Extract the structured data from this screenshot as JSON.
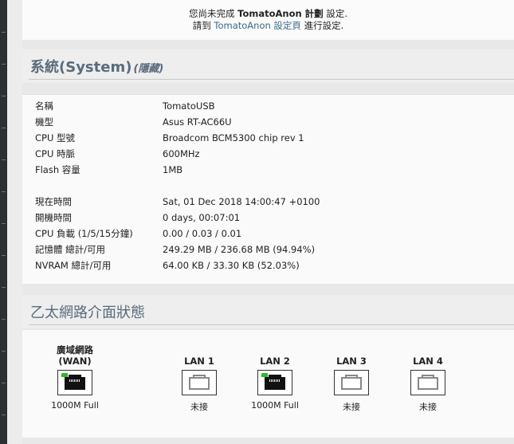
{
  "notice": {
    "line1_prefix": "您尚未完成 ",
    "line1_brand": "TomatoAnon 計劃",
    "line1_suffix": " 設定.",
    "line2_prefix": "請到 ",
    "line2_link": "TomatoAnon 設定頁",
    "line2_suffix": " 進行設定."
  },
  "system": {
    "title": "系統(System)",
    "hide_label": "(隱藏)",
    "rows": [
      {
        "label": "名稱",
        "value": "TomatoUSB"
      },
      {
        "label": "機型",
        "value": "Asus RT-AC66U"
      },
      {
        "label": "CPU 型號",
        "value": "Broadcom BCM5300 chip rev 1"
      },
      {
        "label": "CPU 時脈",
        "value": "600MHz"
      },
      {
        "label": "Flash 容量",
        "value": "1MB"
      },
      {
        "label": "現在時間",
        "value": "Sat, 01 Dec 2018 14:00:47 +0100"
      },
      {
        "label": "開機時間",
        "value": "0 days, 00:07:01"
      },
      {
        "label": "CPU 負載 (1/5/15分鐘)",
        "value": "0.00 / 0.03 / 0.01"
      },
      {
        "label": "記憶體 總計/可用",
        "value": "249.29 MB / 236.68 MB (94.94%)"
      },
      {
        "label": "NVRAM 總計/可用",
        "value": "64.00 KB / 33.30 KB (52.03%)"
      }
    ]
  },
  "ethernet": {
    "title": "乙太網路介面狀態",
    "ports": [
      {
        "label": "廣域網路\n(WAN)",
        "status": "1000M Full",
        "connected": true
      },
      {
        "label": "LAN 1",
        "status": "未接",
        "connected": false
      },
      {
        "label": "LAN 2",
        "status": "1000M Full",
        "connected": true
      },
      {
        "label": "LAN 3",
        "status": "未接",
        "connected": false
      },
      {
        "label": "LAN 4",
        "status": "未接",
        "connected": false
      }
    ]
  },
  "colors": {
    "section_title": "#5a6b7b",
    "link": "#3a6a8a",
    "led": "#2eb82e"
  }
}
